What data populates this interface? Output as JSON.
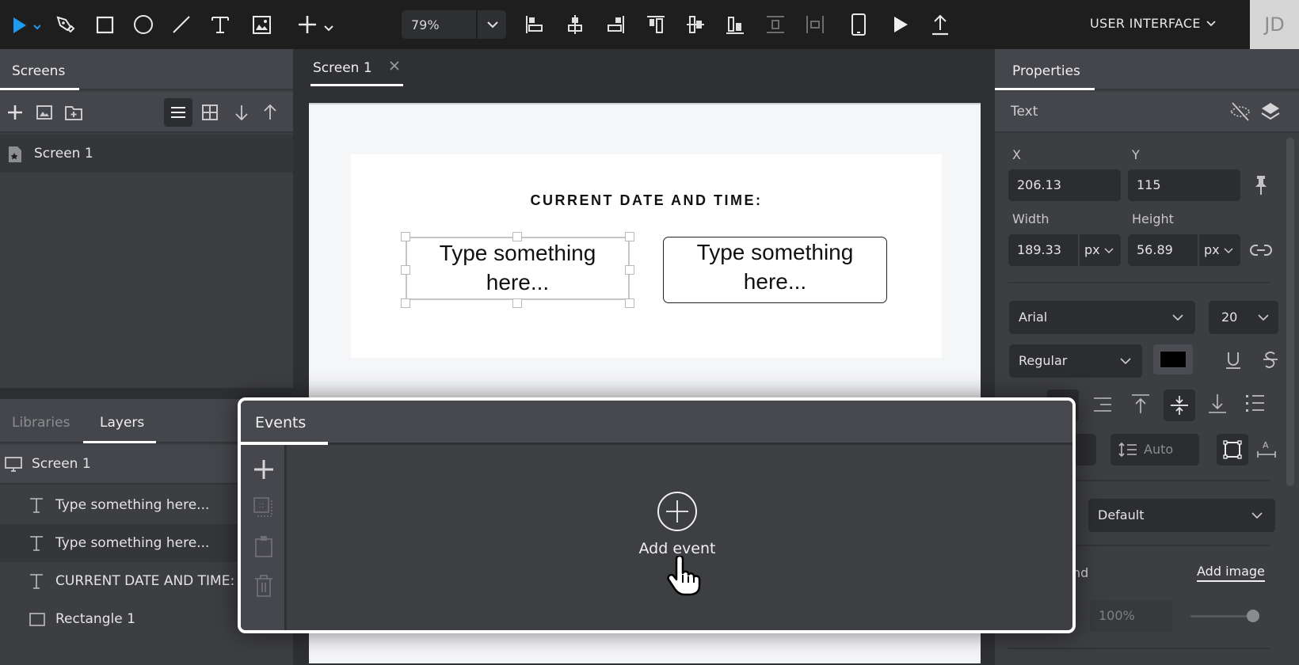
{
  "toolbar": {
    "tools": [
      "select-tool",
      "pen-tool",
      "rectangle-tool",
      "ellipse-tool",
      "line-tool",
      "text-tool",
      "image-tool",
      "add-tool"
    ],
    "zoom_value": "79%",
    "workspace_menu": "USER INTERFACE",
    "avatar_initials": "JD",
    "accent_color": "#1e9bf0"
  },
  "screens_panel": {
    "tab_label": "Screens",
    "items": [
      {
        "label": "Screen 1"
      }
    ]
  },
  "layers_panel": {
    "tabs": [
      "Libraries",
      "Layers"
    ],
    "active_tab": "Layers",
    "root": "Screen 1",
    "layers": [
      {
        "type": "text",
        "label": "Type something here..."
      },
      {
        "type": "text",
        "label": "Type something here..."
      },
      {
        "type": "text",
        "label": "CURRENT DATE AND TIME:"
      },
      {
        "type": "rectangle",
        "label": "Rectangle 1"
      }
    ]
  },
  "canvas": {
    "tab_label": "Screen 1",
    "heading": "CURRENT DATE AND TIME:",
    "textbox1": "Type something here...",
    "textbox2": "Type something here..."
  },
  "properties": {
    "tab_label": "Properties",
    "section": "Text",
    "x_label": "X",
    "x_value": "206.13",
    "y_label": "Y",
    "y_value": "115",
    "width_label": "Width",
    "width_value": "189.33",
    "width_unit": "px",
    "height_label": "Height",
    "height_value": "56.89",
    "height_unit": "px",
    "font_family": "Arial",
    "font_size": "20",
    "font_weight": "Regular",
    "text_color": "#000000",
    "line_height": "Auto",
    "style_select": "Default",
    "background_label_partial": "nd",
    "add_image_link": "Add image",
    "opacity_value": "100%",
    "opacity_fraction": 1.0
  },
  "events_panel": {
    "tab_label": "Events",
    "add_event_label": "Add event"
  }
}
